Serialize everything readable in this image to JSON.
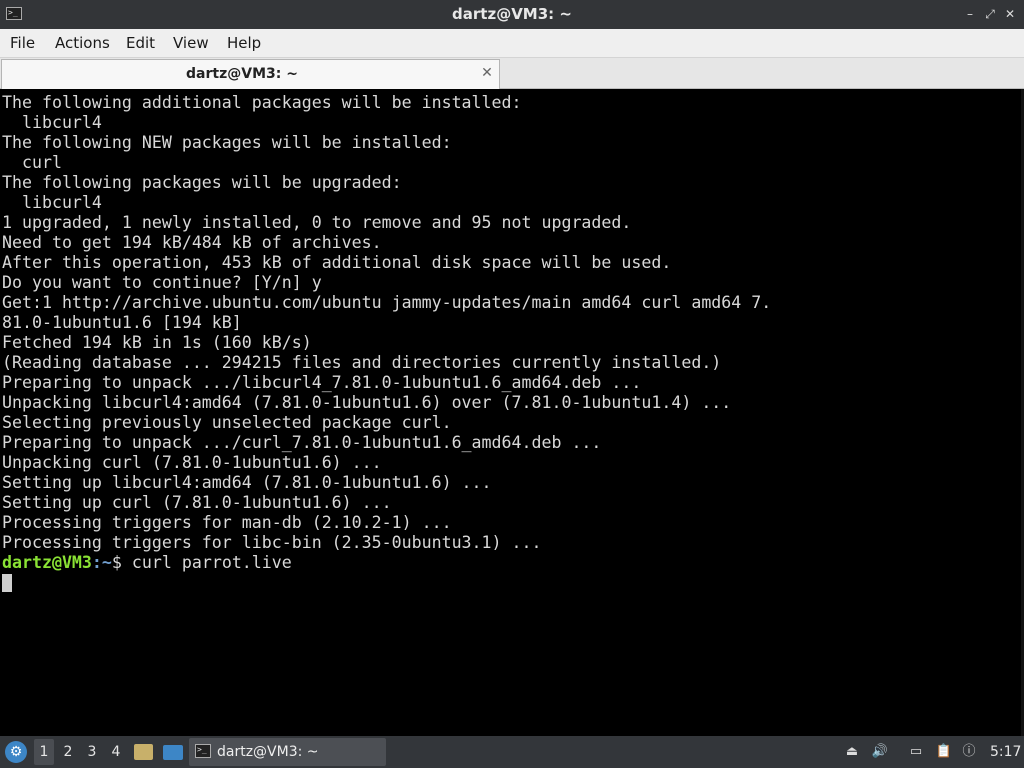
{
  "window": {
    "title": "dartz@VM3: ~",
    "minimize_glyph": "–",
    "maximize_glyph": "⤢",
    "close_glyph": "✕"
  },
  "menubar": {
    "items": [
      "File",
      "Actions",
      "Edit",
      "View",
      "Help"
    ]
  },
  "tabs": [
    {
      "label": "dartz@VM3: ~",
      "close_glyph": "✕"
    }
  ],
  "terminal": {
    "lines": [
      "The following additional packages will be installed:",
      "  libcurl4",
      "The following NEW packages will be installed:",
      "  curl",
      "The following packages will be upgraded:",
      "  libcurl4",
      "1 upgraded, 1 newly installed, 0 to remove and 95 not upgraded.",
      "Need to get 194 kB/484 kB of archives.",
      "After this operation, 453 kB of additional disk space will be used.",
      "Do you want to continue? [Y/n] y",
      "Get:1 http://archive.ubuntu.com/ubuntu jammy-updates/main amd64 curl amd64 7.",
      "81.0-1ubuntu1.6 [194 kB]",
      "Fetched 194 kB in 1s (160 kB/s)",
      "(Reading database ... 294215 files and directories currently installed.)",
      "Preparing to unpack .../libcurl4_7.81.0-1ubuntu1.6_amd64.deb ...",
      "Unpacking libcurl4:amd64 (7.81.0-1ubuntu1.6) over (7.81.0-1ubuntu1.4) ...",
      "Selecting previously unselected package curl.",
      "Preparing to unpack .../curl_7.81.0-1ubuntu1.6_amd64.deb ...",
      "Unpacking curl (7.81.0-1ubuntu1.6) ...",
      "Setting up libcurl4:amd64 (7.81.0-1ubuntu1.6) ...",
      "Setting up curl (7.81.0-1ubuntu1.6) ...",
      "Processing triggers for man-db (2.10.2-1) ...",
      "Processing triggers for libc-bin (2.35-0ubuntu3.1) ..."
    ],
    "prompt": {
      "user_host": "dartz@VM3",
      "separator": ":",
      "path": "~",
      "symbol": "$",
      "command": " curl parrot.live"
    },
    "colors": {
      "background": "#000000",
      "text": "#d9d9d9",
      "prompt_user": "#8ae234",
      "prompt_path": "#729fcf"
    }
  },
  "taskbar": {
    "workspaces": [
      "1",
      "2",
      "3",
      "4"
    ],
    "active_workspace": "1",
    "task_label": "dartz@VM3: ~",
    "clock": "5:17",
    "icons": [
      "start-menu-icon",
      "file-manager-icon",
      "show-desktop-icon",
      "terminal-icon",
      "upload-icon",
      "volume-icon",
      "network-icon",
      "clipboard-icon",
      "update-notifier-icon"
    ]
  }
}
